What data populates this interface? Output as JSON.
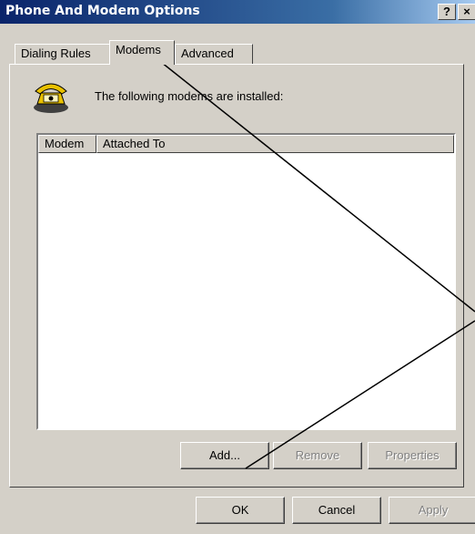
{
  "window": {
    "title": "Phone And Modem Options",
    "help_label": "?",
    "close_label": "×"
  },
  "tabs": [
    {
      "label": "Dialing Rules"
    },
    {
      "label": "Modems"
    },
    {
      "label": "Advanced"
    }
  ],
  "modems": {
    "description": "The following modems are installed:",
    "columns": [
      {
        "label": "Modem"
      },
      {
        "label": "Attached To"
      }
    ],
    "rows": []
  },
  "buttons": {
    "add": "Add...",
    "remove": "Remove",
    "properties": "Properties"
  },
  "footer": {
    "ok": "OK",
    "cancel": "Cancel",
    "apply": "Apply"
  },
  "icons": {
    "phone": "telephone-icon"
  },
  "colors": {
    "titlebar_start": "#0a246a",
    "titlebar_end": "#a6caf0",
    "face": "#d4d0c8"
  }
}
